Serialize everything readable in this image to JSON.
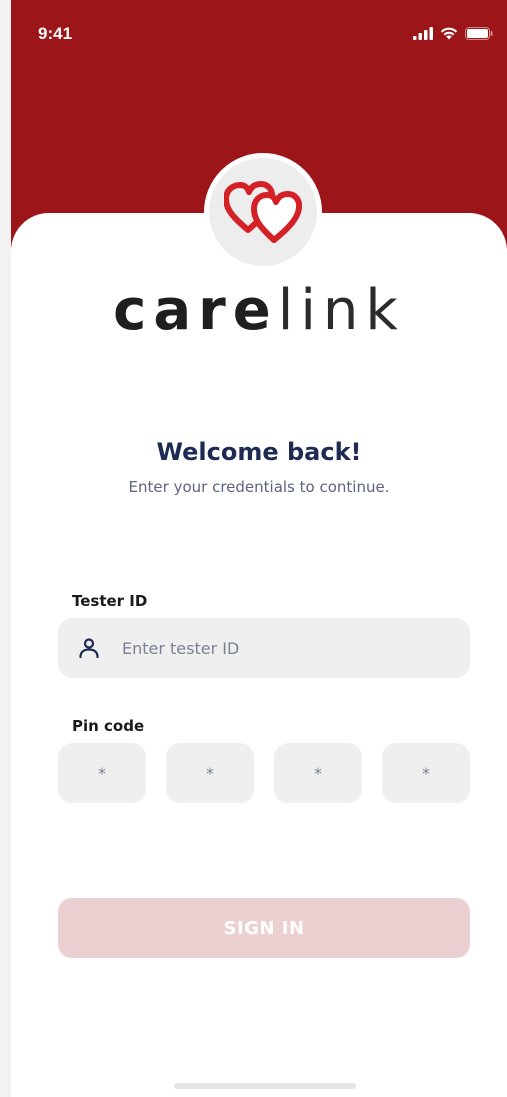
{
  "status_bar": {
    "time": "9:41",
    "icons": [
      "signal-icon",
      "wifi-icon",
      "battery-icon"
    ]
  },
  "colors": {
    "header": "#9c1519",
    "title": "#1e2a52",
    "button_disabled": "#ecd0d1",
    "field_bg": "#efeff0"
  },
  "logo": {
    "icon": "hearts-logo-icon",
    "brand_bold": "care",
    "brand_light": "link"
  },
  "welcome": {
    "title": "Welcome back!",
    "subtitle": "Enter your credentials to continue."
  },
  "form": {
    "tester_id": {
      "label": "Tester ID",
      "placeholder": "Enter tester ID",
      "value": "",
      "icon": "user-icon"
    },
    "pin_code": {
      "label": "Pin code",
      "digits": [
        "*",
        "*",
        "*",
        "*"
      ]
    },
    "submit_label": "SIGN IN"
  }
}
